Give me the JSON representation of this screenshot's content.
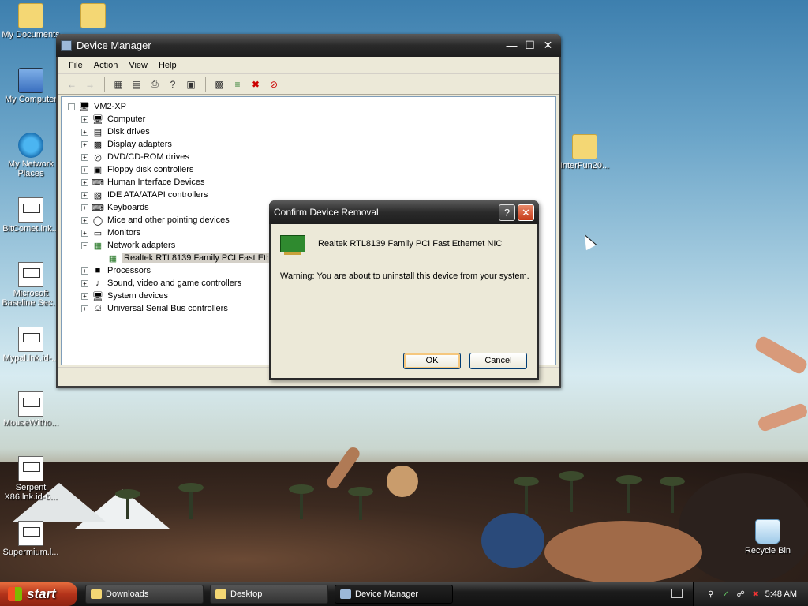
{
  "desktop": {
    "icons": [
      {
        "label": "My Documents",
        "icon": "my-documents-icon"
      },
      {
        "label": "My Computer",
        "icon": "my-computer-icon"
      },
      {
        "label": "My Network Places",
        "icon": "network-places-icon"
      },
      {
        "label": "BitComet.lnk...",
        "icon": "shortcut-file-icon"
      },
      {
        "label": "Microsoft Baseline Sec...",
        "icon": "shortcut-file-icon"
      },
      {
        "label": "Mypal.lnk.id-...",
        "icon": "shortcut-file-icon"
      },
      {
        "label": "MouseWitho...",
        "icon": "shortcut-file-icon"
      },
      {
        "label": "Serpent X86.lnk.id-6...",
        "icon": "shortcut-file-icon"
      },
      {
        "label": "Supermium.l...",
        "icon": "shortcut-file-icon"
      },
      {
        "label": "InterFun20...",
        "icon": "folder-icon"
      },
      {
        "label": "Recycle Bin",
        "icon": "recycle-bin-icon"
      }
    ]
  },
  "device_manager": {
    "title": "Device Manager",
    "menu": [
      "File",
      "Action",
      "View",
      "Help"
    ],
    "toolbar_icons": [
      "back-icon",
      "forward-icon",
      "console-tree-icon",
      "properties-icon",
      "print-icon",
      "help-icon",
      "view-icon",
      "scan-hardware-icon",
      "update-driver-icon",
      "uninstall-icon",
      "disable-icon"
    ],
    "tree": {
      "root": "VM2-XP",
      "items": [
        {
          "label": "Computer",
          "expanded": false,
          "icon": "computer-icon"
        },
        {
          "label": "Disk drives",
          "expanded": false,
          "icon": "disk-drive-icon"
        },
        {
          "label": "Display adapters",
          "expanded": false,
          "icon": "display-adapter-icon"
        },
        {
          "label": "DVD/CD-ROM drives",
          "expanded": false,
          "icon": "cdrom-icon"
        },
        {
          "label": "Floppy disk controllers",
          "expanded": false,
          "icon": "floppy-icon"
        },
        {
          "label": "Human Interface Devices",
          "expanded": false,
          "icon": "hid-icon"
        },
        {
          "label": "IDE ATA/ATAPI controllers",
          "expanded": false,
          "icon": "ide-icon"
        },
        {
          "label": "Keyboards",
          "expanded": false,
          "icon": "keyboard-icon"
        },
        {
          "label": "Mice and other pointing devices",
          "expanded": false,
          "icon": "mouse-icon"
        },
        {
          "label": "Monitors",
          "expanded": false,
          "icon": "monitor-icon"
        },
        {
          "label": "Network adapters",
          "expanded": true,
          "icon": "network-adapter-icon"
        },
        {
          "label": "Realtek RTL8139 Family PCI Fast Ether",
          "child": true,
          "selected": true,
          "icon": "nic-icon"
        },
        {
          "label": "Processors",
          "expanded": false,
          "icon": "processor-icon"
        },
        {
          "label": "Sound, video and game controllers",
          "expanded": false,
          "icon": "sound-icon"
        },
        {
          "label": "System devices",
          "expanded": false,
          "icon": "system-icon"
        },
        {
          "label": "Universal Serial Bus controllers",
          "expanded": false,
          "icon": "usb-icon"
        }
      ]
    }
  },
  "dialog": {
    "title": "Confirm Device Removal",
    "device_name": "Realtek RTL8139 Family PCI Fast Ethernet NIC",
    "warning": "Warning: You are about to uninstall this device from your system.",
    "ok_label": "OK",
    "cancel_label": "Cancel",
    "help_glyph": "?",
    "close_glyph": "✕"
  },
  "taskbar": {
    "start_label": "start",
    "tasks": [
      {
        "label": "Downloads",
        "active": false
      },
      {
        "label": "Desktop",
        "active": false
      },
      {
        "label": "Device Manager",
        "active": true
      }
    ],
    "clock": "5:48 AM"
  }
}
